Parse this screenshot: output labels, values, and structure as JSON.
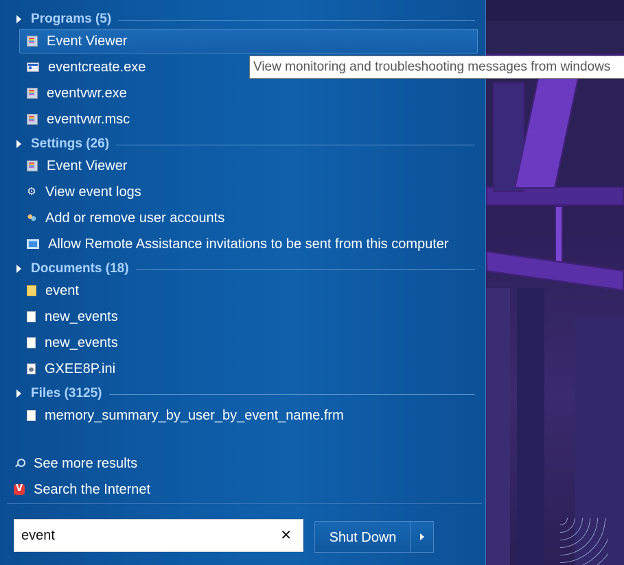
{
  "sections": {
    "programs": "Programs (5)",
    "settings": "Settings (26)",
    "documents": "Documents (18)",
    "files": "Files (3125)"
  },
  "programs": [
    {
      "label": "Event Viewer",
      "icon": "event-viewer-icon"
    },
    {
      "label": "eventcreate.exe",
      "icon": "exe-icon"
    },
    {
      "label": "eventvwr.exe",
      "icon": "event-viewer-icon"
    },
    {
      "label": "eventvwr.msc",
      "icon": "event-viewer-icon"
    }
  ],
  "settings": [
    {
      "label": "Event Viewer",
      "icon": "event-viewer-icon"
    },
    {
      "label": "View event logs",
      "icon": "gear-icon"
    },
    {
      "label": "Add or remove user accounts",
      "icon": "users-icon"
    },
    {
      "label": "Allow Remote Assistance invitations to be sent from this computer",
      "icon": "remote-assistance-icon"
    }
  ],
  "documents": [
    {
      "label": "event",
      "icon": "folder-icon"
    },
    {
      "label": "new_events",
      "icon": "document-icon"
    },
    {
      "label": "new_events",
      "icon": "document-icon"
    },
    {
      "label": "GXEE8P.ini",
      "icon": "ini-file-icon"
    }
  ],
  "files": [
    {
      "label": "memory_summary_by_user_by_event_name.frm",
      "icon": "document-icon"
    }
  ],
  "links": {
    "see_more": "See more results",
    "search_internet": "Search the Internet"
  },
  "search": {
    "value": "event",
    "clear_glyph": "✕"
  },
  "shutdown": {
    "label": "Shut Down"
  },
  "tooltip": "View monitoring and troubleshooting messages from windows",
  "colors": {
    "section_title": "#a9d3ff",
    "panel": "#0d5aa4",
    "hover": "#1c6ab6"
  }
}
